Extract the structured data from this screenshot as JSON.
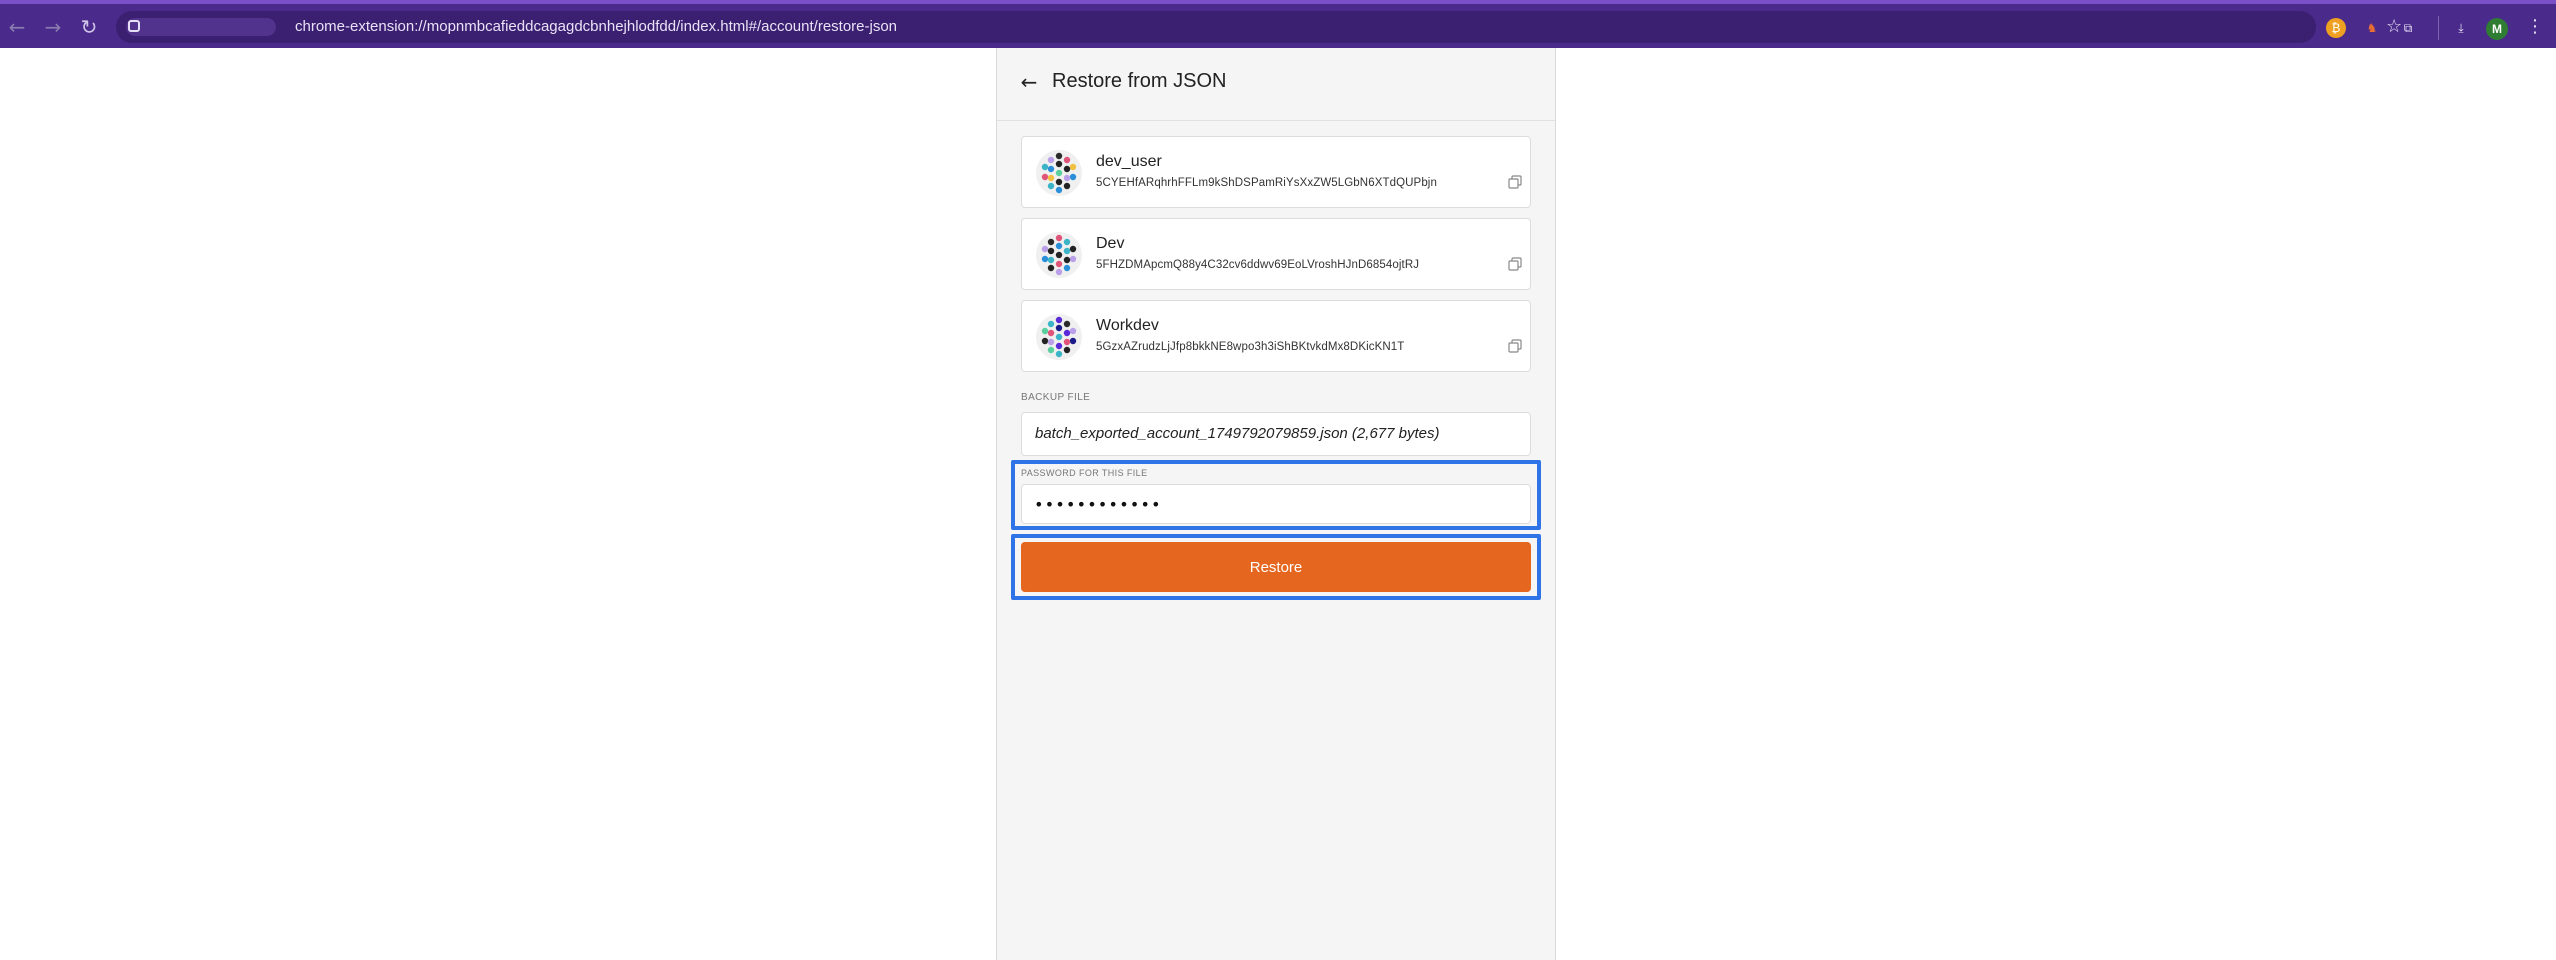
{
  "browser": {
    "url": "chrome-extension://mopnmbcafieddcagagdcbnhejhlodfdd/index.html#/account/restore-json",
    "avatar_initial": "M"
  },
  "header": {
    "title": "Restore from JSON"
  },
  "accounts": [
    {
      "name": "dev_user",
      "address": "5CYEHfARqhrhFFLm9kShDSPamRiYsXxZW5LGbN6XTdQUPbjn"
    },
    {
      "name": "Dev",
      "address": "5FHZDMApcmQ88y4C32cv6ddwv69EoLVroshHJnD6854ojtRJ"
    },
    {
      "name": "Workdev",
      "address": "5GzxAZrudzLjJfp8bkkNE8wpo3h3iShBKtvkdMx8DKicKN1T"
    }
  ],
  "backup": {
    "label": "BACKUP FILE",
    "file_info": "batch_exported_account_1749792079859.json (2,677 bytes)"
  },
  "password": {
    "label": "PASSWORD FOR THIS FILE",
    "value": "••••••••••••"
  },
  "actions": {
    "restore_label": "Restore"
  },
  "colors": {
    "accent": "#e4661f",
    "highlight": "#2f74e6",
    "browser_bar": "#4a2a8a"
  }
}
